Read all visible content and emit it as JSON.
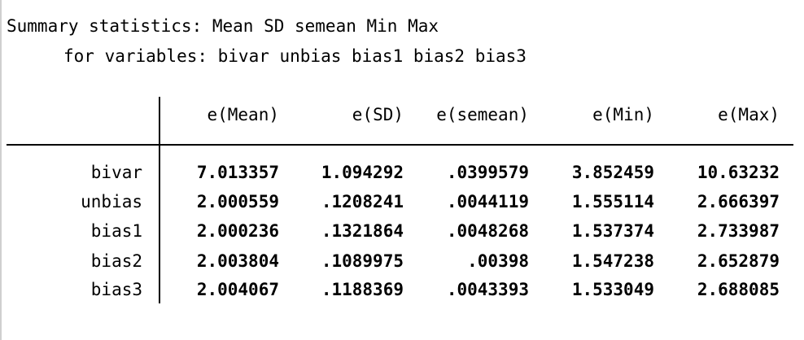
{
  "header": {
    "line1": "Summary statistics: Mean SD semean Min Max",
    "line2": "for variables: bivar unbias bias1 bias2 bias3"
  },
  "table": {
    "columns": [
      "e(Mean)",
      "e(SD)",
      "e(semean)",
      "e(Min)",
      "e(Max)"
    ],
    "rows": [
      {
        "label": "bivar",
        "values": [
          "7.013357",
          "1.094292",
          ".0399579",
          "3.852459",
          "10.63232"
        ]
      },
      {
        "label": "unbias",
        "values": [
          "2.000559",
          ".1208241",
          ".0044119",
          "1.555114",
          "2.666397"
        ]
      },
      {
        "label": "bias1",
        "values": [
          "2.000236",
          ".1321864",
          ".0048268",
          "1.537374",
          "2.733987"
        ]
      },
      {
        "label": "bias2",
        "values": [
          "2.003804",
          ".1089975",
          ".00398",
          "1.547238",
          "2.652879"
        ]
      },
      {
        "label": "bias3",
        "values": [
          "2.004067",
          ".1188369",
          ".0043393",
          "1.533049",
          "2.688085"
        ]
      }
    ]
  }
}
